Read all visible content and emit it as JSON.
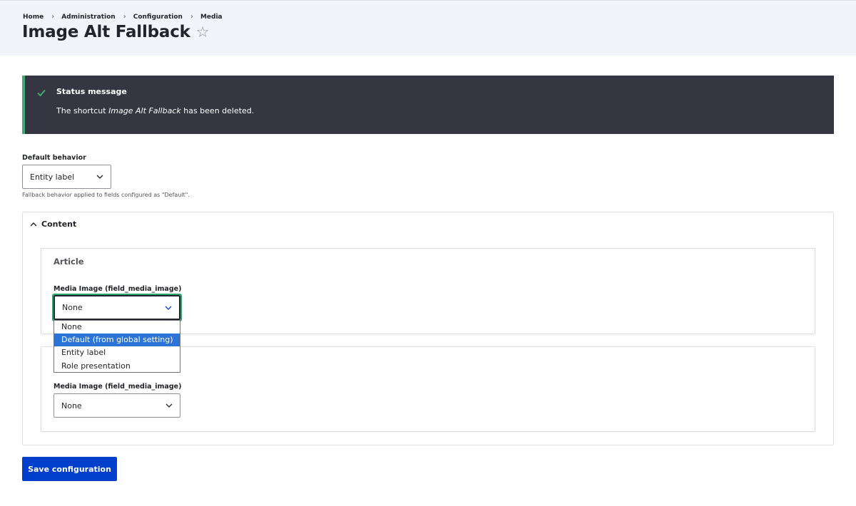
{
  "breadcrumb": [
    "Home",
    "Administration",
    "Configuration",
    "Media"
  ],
  "page": {
    "title": "Image Alt Fallback"
  },
  "status": {
    "title": "Status message",
    "text_prefix": "The shortcut ",
    "text_em": "Image Alt Fallback",
    "text_suffix": " has been deleted."
  },
  "default_behavior": {
    "label": "Default behavior",
    "value": "Entity label",
    "description": "Fallback behavior applied to fields configured as \"Default\"."
  },
  "content_section": {
    "summary": "Content",
    "fieldsets": [
      {
        "legend": "Article",
        "field_label": "Media Image (field_media_image)",
        "value": "None"
      },
      {
        "legend": "",
        "field_label": "Media Image (field_media_image)",
        "value": "None"
      }
    ]
  },
  "dropdown": {
    "options": [
      "None",
      "Default (from global setting)",
      "Entity label",
      "Role presentation"
    ],
    "highlighted": "Default (from global setting)"
  },
  "actions": {
    "save_label": "Save configuration"
  },
  "colors": {
    "accent": "#003ecc",
    "status_bg": "#353641",
    "success": "#42a877",
    "focus": "#26a769",
    "highlight": "#2c74d6"
  }
}
